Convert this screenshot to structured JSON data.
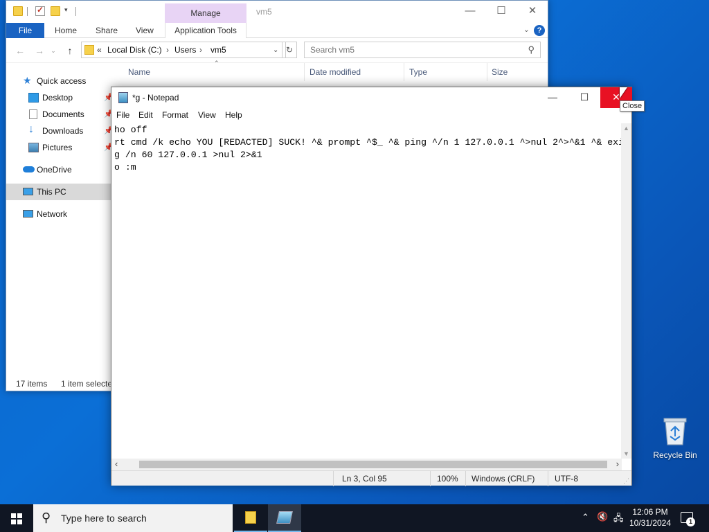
{
  "desktop": {
    "recycle_bin_label": "Recycle Bin"
  },
  "explorer": {
    "window_title": "vm5",
    "ribbon_tabs": {
      "file": "File",
      "home": "Home",
      "share": "Share",
      "view": "View",
      "manage": "Manage",
      "application_tools": "Application Tools"
    },
    "breadcrumb": {
      "prefix": "«",
      "items": [
        "Local Disk (C:)",
        "Users",
        "vm5"
      ],
      "separator": "›"
    },
    "search_placeholder": "Search vm5",
    "columns": [
      "Name",
      "Date modified",
      "Type",
      "Size"
    ],
    "nav": [
      {
        "label": "Quick access",
        "icon": "star-icon"
      },
      {
        "label": "Desktop",
        "icon": "desktop-icon",
        "pinned": true
      },
      {
        "label": "Documents",
        "icon": "documents-icon",
        "pinned": true
      },
      {
        "label": "Downloads",
        "icon": "downloads-icon",
        "pinned": true
      },
      {
        "label": "Pictures",
        "icon": "pictures-icon",
        "pinned": true
      },
      {
        "label": "OneDrive",
        "icon": "onedrive-icon"
      },
      {
        "label": "This PC",
        "icon": "this-pc-icon",
        "selected": true
      },
      {
        "label": "Network",
        "icon": "network-icon"
      }
    ],
    "status_items": "17 items",
    "status_selected": "1 item selecte"
  },
  "notepad": {
    "title": "*g - Notepad",
    "menu": [
      "File",
      "Edit",
      "Format",
      "View",
      "Help"
    ],
    "lines": [
      "ho off",
      "",
      "rt cmd /k echo YOU [REDACTED] SUCK! ^& prompt ^$_ ^& ping ^/n 1 127.0.0.1 ^>nul 2^>^&1 ^& exit",
      "g /n 60 127.0.0.1 >nul 2>&1",
      "o :m"
    ],
    "status": {
      "position": "Ln 3, Col 95",
      "zoom": "100%",
      "line_ending": "Windows (CRLF)",
      "encoding": "UTF-8"
    },
    "close_tooltip": "Close"
  },
  "taskbar": {
    "search_placeholder": "Type here to search",
    "time": "12:06 PM",
    "date": "10/31/2024",
    "notification_count": "1"
  },
  "colors": {
    "desktop_blue": "#0a63c9",
    "close_red": "#e81123",
    "file_tab_blue": "#1a63c2",
    "manage_purple": "#e8d4f5",
    "taskbar": "#101623"
  }
}
